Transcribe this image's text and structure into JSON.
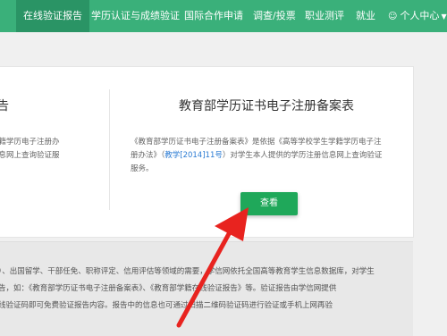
{
  "nav": {
    "items": [
      {
        "label": "在线验证报告",
        "active": true
      },
      {
        "label": "学历认证与成绩验证",
        "active": false
      },
      {
        "label": "国际合作申请",
        "active": false
      },
      {
        "label": "调查/投票",
        "active": false
      },
      {
        "label": "职业测评",
        "active": false
      },
      {
        "label": "就业",
        "active": false
      }
    ],
    "user_center": "个人中心"
  },
  "left_card": {
    "title": "告",
    "desc_lines": [
      "学籍学历电子注册办",
      "信息网上查询验证服"
    ]
  },
  "right_card": {
    "title": "教育部学历证书电子注册备案表",
    "desc_line1": "《教育部学历证书电子注册备案表》是依据《高等学校学生学籍学历电子注",
    "desc_line2_pre": "册办法》（",
    "desc_line2_link": "教学[2014]11号",
    "desc_line2_post": "）对学生本人提供的学历注册信息网上查询验证",
    "desc_line3": "服务。",
    "button_label": "查看"
  },
  "notice": {
    "lines": [
      "）、出国留学、干部任免、职称评定、信用评估等领域的需要，学信网依托全国高等教育学生信息数据库，对学生",
      "告，如：《教育部学历证书电子注册备案表》、《教育部学籍在线验证报告》等。验证报告由学信网提供",
      "线验证码即可免费验证报告内容。报告中的信息也可通过扫描二维码验证码进行验证或手机上网再验"
    ]
  },
  "colors": {
    "nav_bg": "#3ab07a",
    "nav_active": "#2a9465",
    "button": "#1fa85a",
    "arrow": "#e8231f",
    "link": "#2b7bd3"
  }
}
